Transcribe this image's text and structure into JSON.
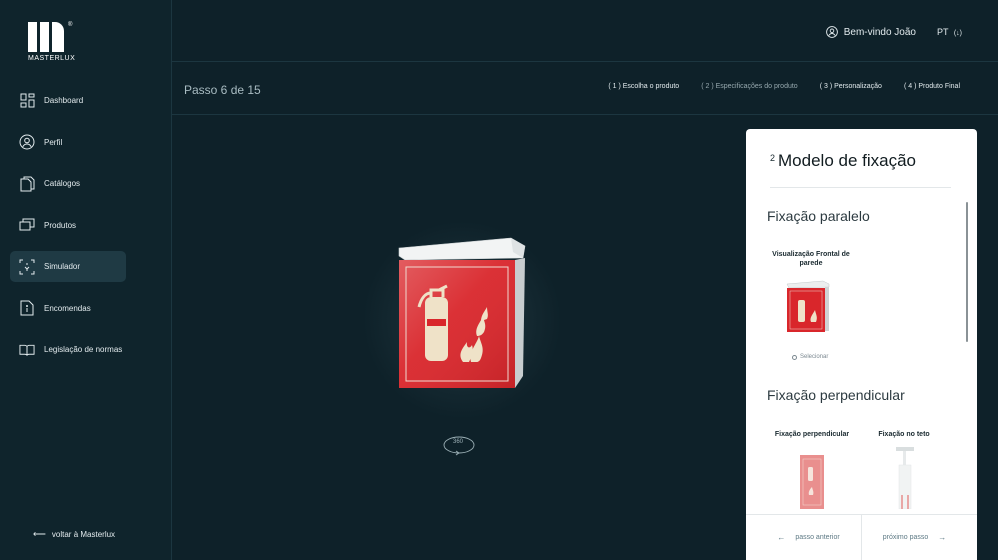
{
  "brand": {
    "name": "MASTERLUX",
    "reg": "®"
  },
  "sidebar": {
    "items": [
      {
        "label": "Dashboard",
        "icon": "dashboard-icon",
        "active": false
      },
      {
        "label": "Perfil",
        "icon": "user-icon",
        "active": false
      },
      {
        "label": "Catálogos",
        "icon": "catalog-icon",
        "active": false
      },
      {
        "label": "Produtos",
        "icon": "products-icon",
        "active": false
      },
      {
        "label": "Simulador",
        "icon": "simulator-icon",
        "active": true
      },
      {
        "label": "Encomendas",
        "icon": "orders-icon",
        "active": false
      },
      {
        "label": "Legislação de normas",
        "icon": "book-icon",
        "active": false
      }
    ],
    "back_label": "voltar à Masterlux"
  },
  "header": {
    "welcome": "Bem-vindo João",
    "lang": "PT",
    "lang_caret": "(↓)"
  },
  "stepbar": {
    "counter": "Passo 6 de 15",
    "steps": [
      "( 1 ) Escolha o produto",
      "( 2 ) Especificações do produto",
      "( 3 ) Personalização",
      "( 4 ) Produto Final"
    ]
  },
  "viewer": {
    "rotate_label": "360"
  },
  "panel": {
    "step_num": "2",
    "title": "Modelo de fixação",
    "section1": "Fixação paralelo",
    "card1_label": "Visualização Frontal de parede",
    "select_label": "Selecionar",
    "section2": "Fixação perpendicular",
    "card2_label": "Fixação perpendicular",
    "card3_label": "Fixação no teto",
    "prev": "passo anterior",
    "next": "próximo passo"
  },
  "colors": {
    "sign_red": "#d9262b",
    "background": "#0e2129",
    "active_nav": "#1f3a44"
  }
}
